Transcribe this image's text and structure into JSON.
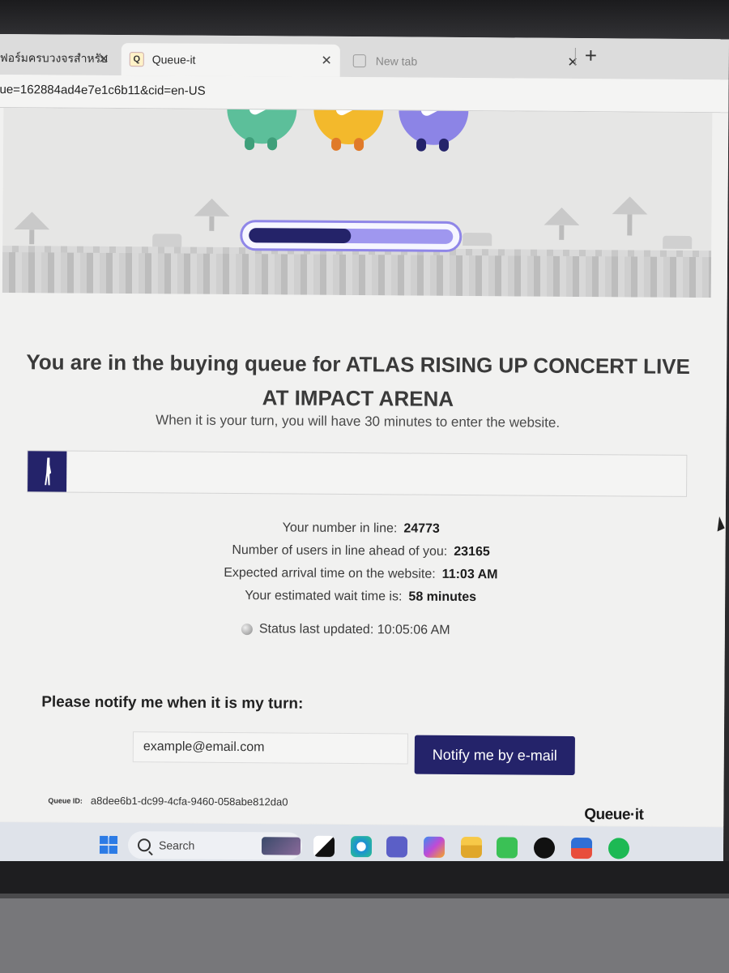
{
  "browser": {
    "tabs": [
      {
        "label": "ฟอร์มครบวงจรสำหรับ"
      },
      {
        "label": "Queue-it"
      },
      {
        "label": "New tab"
      }
    ],
    "url": "ue=162884ad4e7e1c6b11&cid=en-US"
  },
  "queue": {
    "progress_fraction": 0.5,
    "title": "You are in the buying queue for ATLAS RISING UP CONCERT LIVE AT IMPACT ARENA",
    "subtitle": "When it is your turn, you will have 30 minutes to enter the website.",
    "stats": [
      {
        "label": "Your number in line:",
        "value": "24773"
      },
      {
        "label": "Number of users in line ahead of you:",
        "value": "23165"
      },
      {
        "label": "Expected arrival time on the website:",
        "value": "11:03 AM"
      },
      {
        "label": "Your estimated wait time is:",
        "value": "58 minutes"
      }
    ],
    "status_text": "Status last updated: 10:05:06 AM"
  },
  "notify": {
    "heading": "Please notify me when it is my turn:",
    "email_value": "example@email.com",
    "button_label": "Notify me by e-mail"
  },
  "footer": {
    "queue_id_label": "Queue ID:",
    "queue_id": "a8dee6b1-dc99-4cfa-9460-058abe812da0",
    "brand": "Queue·it"
  },
  "taskbar": {
    "search_label": "Search"
  },
  "colors": {
    "accent": "#24236a",
    "progress_border": "#8f86e8",
    "mascot_green": "#5cbf9a",
    "mascot_yellow": "#f3b92c",
    "mascot_purple": "#8c84e6"
  }
}
